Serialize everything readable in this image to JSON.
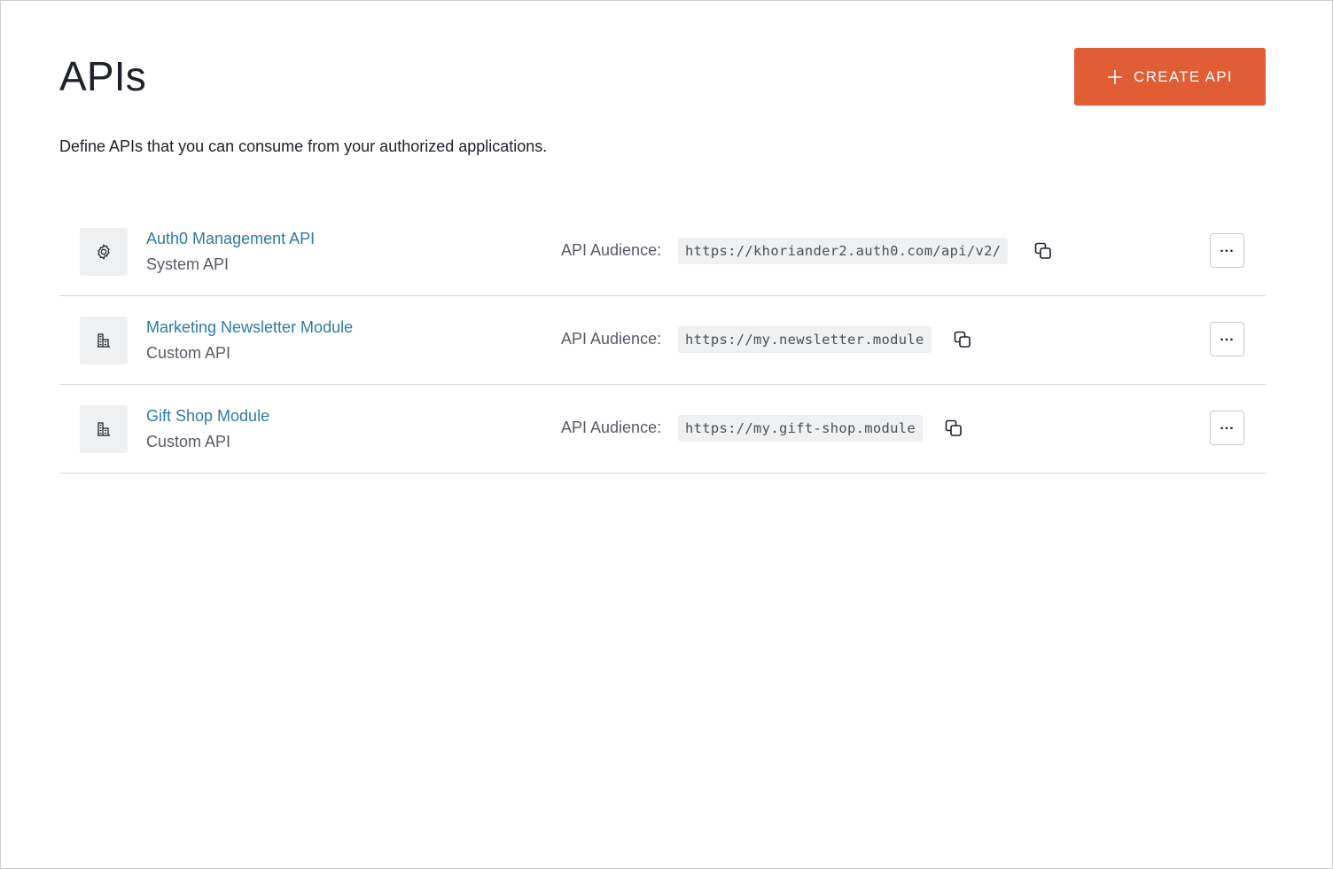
{
  "header": {
    "title": "APIs",
    "create_button_label": "CREATE API",
    "subtitle": "Define APIs that you can consume from your authorized applications."
  },
  "colors": {
    "accent": "#e05d36",
    "link": "#2e7aa6"
  },
  "apis": [
    {
      "name": "Auth0 Management API",
      "type": "System API",
      "icon": "gear-icon",
      "audience_label": "API Audience:",
      "audience": "https://khoriander2.auth0.com/api/v2/"
    },
    {
      "name": "Marketing Newsletter Module",
      "type": "Custom API",
      "icon": "building-icon",
      "audience_label": "API Audience:",
      "audience": "https://my.newsletter.module"
    },
    {
      "name": "Gift Shop Module",
      "type": "Custom API",
      "icon": "building-icon",
      "audience_label": "API Audience:",
      "audience": "https://my.gift-shop.module"
    }
  ]
}
